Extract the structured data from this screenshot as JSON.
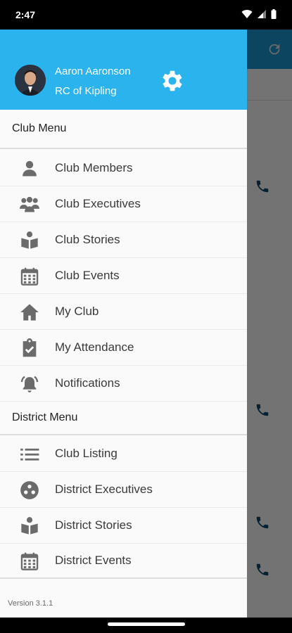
{
  "status_bar": {
    "time": "2:47"
  },
  "drawer": {
    "user": {
      "name": "Aaron Aaronson",
      "club": "RC of Kipling"
    },
    "club_menu": {
      "title": "Club Menu",
      "items": [
        {
          "label": "Club Members",
          "icon": "person-icon"
        },
        {
          "label": "Club Executives",
          "icon": "group-icon"
        },
        {
          "label": "Club Stories",
          "icon": "book-reader-icon"
        },
        {
          "label": "Club Events",
          "icon": "calendar-icon"
        },
        {
          "label": "My Club",
          "icon": "home-icon"
        },
        {
          "label": "My Attendance",
          "icon": "clipboard-check-icon"
        },
        {
          "label": "Notifications",
          "icon": "bell-ring-icon"
        }
      ]
    },
    "district_menu": {
      "title": "District Menu",
      "items": [
        {
          "label": "Club Listing",
          "icon": "list-icon"
        },
        {
          "label": "District Executives",
          "icon": "people-circle-icon"
        },
        {
          "label": "District Stories",
          "icon": "book-reader-icon"
        },
        {
          "label": "District Events",
          "icon": "calendar-icon"
        }
      ]
    },
    "version": "Version 3.1.1"
  },
  "colors": {
    "header": "#2ab3ec",
    "toolbar": "#1b9ad6",
    "icon": "#6b6b6b",
    "phone_icon": "#0d4a6e"
  }
}
